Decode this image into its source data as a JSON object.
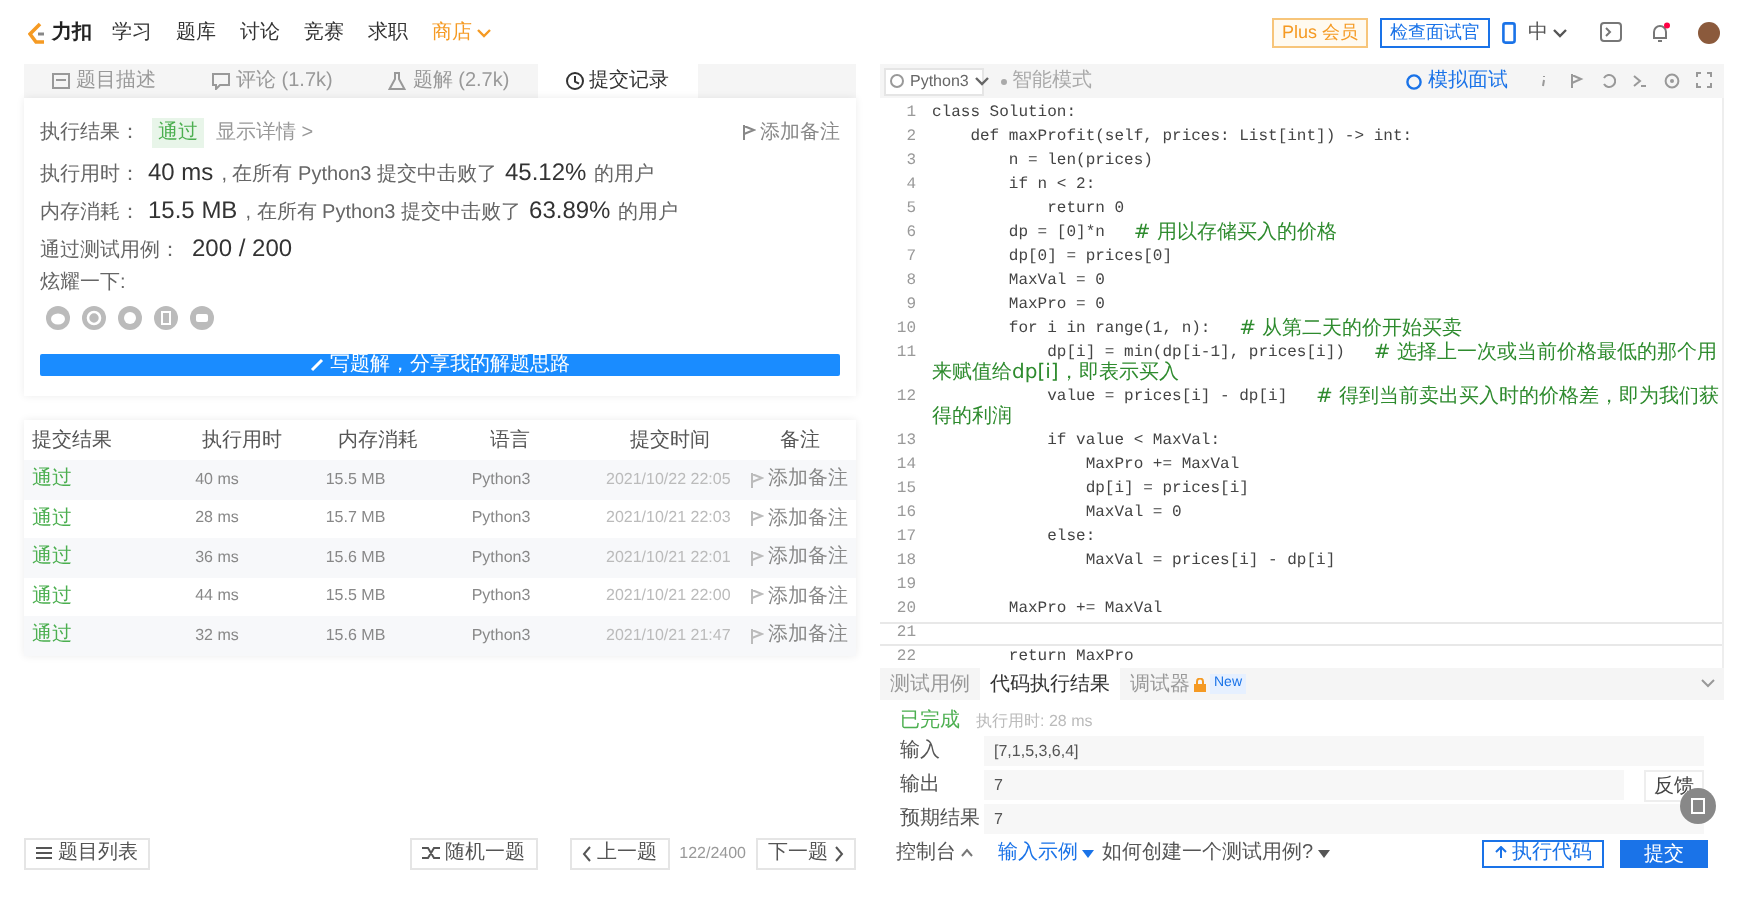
{
  "header": {
    "logo": "力扣",
    "nav": [
      {
        "label": "学习",
        "kind": "link"
      },
      {
        "label": "题库",
        "kind": "link"
      },
      {
        "label": "讨论",
        "kind": "link"
      },
      {
        "label": "竞赛",
        "kind": "link"
      },
      {
        "label": "求职",
        "kind": "link"
      },
      {
        "label": "商店",
        "kind": "shop"
      }
    ],
    "plus_button": "Plus 会员",
    "interview_button": "检查面试官",
    "language": "中"
  },
  "left_tabs": [
    {
      "label": "题目描述",
      "kind": "doc",
      "selected": false
    },
    {
      "label": "评论 (1.7k)",
      "kind": "comment",
      "selected": false
    },
    {
      "label": "题解 (2.7k)",
      "kind": "flask",
      "selected": false
    },
    {
      "label": "提交记录",
      "kind": "clock",
      "selected": true
    }
  ],
  "result": {
    "label": "执行结果：",
    "status": "通过",
    "details": "显示详情 >",
    "note": "添加备注"
  },
  "stats": [
    {
      "label": "执行用时：",
      "value": "40 ms",
      "before": ", 在所有 Python3 提交中击败了",
      "percent": "45.12%",
      "after": "的用户"
    },
    {
      "label": "内存消耗：",
      "value": "15.5 MB",
      "before": ", 在所有 Python3 提交中击败了",
      "percent": "63.89%",
      "after": "的用户"
    }
  ],
  "passed": {
    "label": "通过测试用例：",
    "value": "200 / 200"
  },
  "share_label": "炫耀一下:",
  "write_button": "写题解，分享我的解题思路",
  "table": {
    "columns": [
      "提交结果",
      "执行用时",
      "内存消耗",
      "语言",
      "提交时间",
      "备注"
    ],
    "rows": [
      {
        "result": "通过",
        "time": "40 ms",
        "memory": "15.5 MB",
        "language": "Python3",
        "submitted": "2021/10/22 22:05",
        "note": "添加备注"
      },
      {
        "result": "通过",
        "time": "28 ms",
        "memory": "15.7 MB",
        "language": "Python3",
        "submitted": "2021/10/21 22:03",
        "note": "添加备注"
      },
      {
        "result": "通过",
        "time": "36 ms",
        "memory": "15.6 MB",
        "language": "Python3",
        "submitted": "2021/10/21 22:01",
        "note": "添加备注"
      },
      {
        "result": "通过",
        "time": "44 ms",
        "memory": "15.5 MB",
        "language": "Python3",
        "submitted": "2021/10/21 22:00",
        "note": "添加备注"
      },
      {
        "result": "通过",
        "time": "32 ms",
        "memory": "15.6 MB",
        "language": "Python3",
        "submitted": "2021/10/21 21:47",
        "note": "添加备注"
      }
    ]
  },
  "pager": {
    "list_button": "题目列表",
    "random_button": "随机一题",
    "prev_button": "上一题",
    "counter": "122/2400",
    "next_button": "下一题"
  },
  "editor": {
    "language": "Python3",
    "mode": "智能模式",
    "mock_button": "模拟面试",
    "lines": [
      {
        "number": "1",
        "code": "class Solution:",
        "current": false
      },
      {
        "number": "2",
        "code": "    def maxProfit(self, prices: List[int]) -> int:",
        "current": false
      },
      {
        "number": "3",
        "code": "        n = len(prices)",
        "current": false
      },
      {
        "number": "4",
        "code": "        if n < 2:",
        "current": false
      },
      {
        "number": "5",
        "code": "            return 0",
        "current": false
      },
      {
        "number": "6",
        "code": "        dp = [0]*n   ",
        "comment": "# 用以存储买入的价格",
        "current": false
      },
      {
        "number": "7",
        "code": "        dp[0] = prices[0]",
        "current": false
      },
      {
        "number": "8",
        "code": "        MaxVal = 0",
        "current": false
      },
      {
        "number": "9",
        "code": "        MaxPro = 0",
        "current": false
      },
      {
        "number": "10",
        "code": "        for i in range(1, n):   ",
        "comment": "# 从第二天的价开始买卖",
        "current": false
      },
      {
        "number": "11",
        "code": "            dp[i] = min(dp[i-1], prices[i])   ",
        "comment": "# 选择上一次或当前价格最低的那个用来赋值给dp[i]，即表示买入",
        "current": false
      },
      {
        "number": "12",
        "code": "            value = prices[i] - dp[i]   ",
        "comment": "# 得到当前卖出买入时的价格差，即为我们获得的利润",
        "current": false
      },
      {
        "number": "13",
        "code": "            if value < MaxVal:",
        "current": false
      },
      {
        "number": "14",
        "code": "                MaxPro += MaxVal",
        "current": false
      },
      {
        "number": "15",
        "code": "                dp[i] = prices[i]",
        "current": false
      },
      {
        "number": "16",
        "code": "                MaxVal = 0",
        "current": false
      },
      {
        "number": "17",
        "code": "            else:",
        "current": false
      },
      {
        "number": "18",
        "code": "                MaxVal = prices[i] - dp[i]",
        "current": false
      },
      {
        "number": "19",
        "current": false
      },
      {
        "number": "20",
        "code": "        MaxPro += MaxVal",
        "current": false
      },
      {
        "number": "21",
        "current": true
      },
      {
        "number": "22",
        "code": "        return MaxPro",
        "current": false
      }
    ]
  },
  "console": {
    "tabs": [
      {
        "label": "测试用例",
        "selected": false
      },
      {
        "label": "代码执行结果",
        "selected": true
      },
      {
        "label": "调试器",
        "selected": false,
        "badge": "New"
      }
    ],
    "status": "已完成",
    "runtime": "执行用时: 28 ms",
    "fields": [
      {
        "label": "输入",
        "value": "[7,1,5,3,6,4]"
      },
      {
        "label": "输出",
        "value": "7"
      },
      {
        "label": "预期结果",
        "value": "7"
      }
    ],
    "feedback": "反馈",
    "footer": {
      "console_toggle": "控制台",
      "sample": "输入示例",
      "help": "如何创建一个测试用例?",
      "run_button": "执行代码",
      "submit_button": "提交"
    }
  }
}
